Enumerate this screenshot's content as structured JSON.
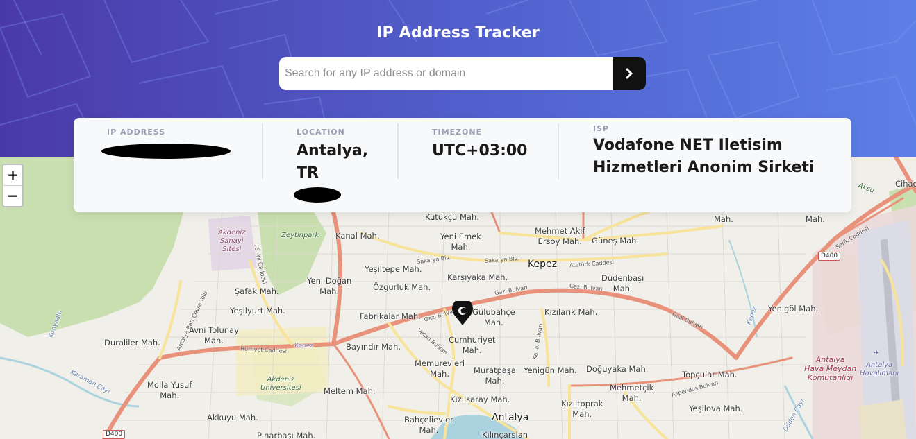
{
  "header": {
    "title": "IP Address Tracker",
    "search": {
      "placeholder": "Search for any IP address or domain",
      "value": "",
      "submit_icon": "chevron-right-icon"
    }
  },
  "info": {
    "ip_address": {
      "label": "IP ADDRESS",
      "value": ""
    },
    "location": {
      "label": "LOCATION",
      "value_line1": "Antalya,",
      "value_line2": "TR"
    },
    "timezone": {
      "label": "TIMEZONE",
      "value": "UTC+03:00"
    },
    "isp": {
      "label": "ISP",
      "value_line1": "Vodafone NET Iletisim",
      "value_line2": "Hizmetleri Anonim Sirketi"
    }
  },
  "map": {
    "zoom_in": "+",
    "zoom_out": "−",
    "marker_icon": "location-pin-icon",
    "labels": {
      "kutukcu": "Kütükçü Mah.",
      "kanal": "Kanal Mah.",
      "yeni_emek_1": "Yeni Emek",
      "yeni_emek_2": "Mah.",
      "mehmet_akif_1": "Mehmet Akif",
      "mehmet_akif_2": "Ersoy Mah.",
      "gunes": "Güneş Mah.",
      "kepez": "Kepez",
      "yesiltepe": "Yeşiltepe Mah.",
      "yeni_dogan_1": "Yeni Doğan",
      "yeni_dogan_2": "Mah.",
      "ozgurluk": "Özgürlük Mah.",
      "karsiyaka": "Karşıyaka Mah.",
      "dudenbasi_1": "Düdenbaşı",
      "dudenbasi_2": "Mah.",
      "safak": "Şafak Mah.",
      "yesilyurt": "Yeşilyurt Mah.",
      "fabrikalar": "Fabrikalar Mah.",
      "gulubahce_1": "Gülubahçe",
      "gulubahce_2": "Mah.",
      "kizilarik": "Kızılarık Mah.",
      "yenigol": "Yenigöl Mah.",
      "avni_1": "Avni Tolunay",
      "avni_2": "Mah.",
      "duraliler": "Duraliler Mah.",
      "bayindir": "Bayındır Mah.",
      "cumhuriyet_1": "Cumhuriyet",
      "cumhuriyet_2": "Mah.",
      "memurevleri_1": "Memurevleri",
      "memurevleri_2": "Mah.",
      "muratpasa_1": "Muratpaşa",
      "muratpasa_2": "Mah.",
      "yenigun": "Yenigün Mah.",
      "doguyaka": "Doğuyaka Mah.",
      "topcular": "Topçular Mah.",
      "molla_1": "Molla Yusuf",
      "molla_2": "Mah.",
      "meltem": "Meltem Mah.",
      "mehmetcik_1": "Mehmetçik",
      "mehmetcik_2": "Mah.",
      "kizilsaray": "Kızılsaray Mah.",
      "kiziltoprak_1": "Kızıltoprak",
      "kiziltoprak_2": "Mah.",
      "akkuyu": "Akkuyu Mah.",
      "bahcelievler_1": "Bahçelievler",
      "bahcelievler_2": "Mah.",
      "antalya": "Antalya",
      "yesilova": "Yeşilova Mah.",
      "pinarbasi": "Pınarbaşı Mah.",
      "kilincarslan": "Kılınçarslan",
      "mah_top_right_1": "Mah.",
      "mah_top_right_2": "Mah.",
      "cihad": "Cihad",
      "aksu": "Aksu",
      "zeytinpark": "Zeytinpark",
      "akdeniz_sanayi_1": "Akdeniz",
      "akdeniz_sanayi_2": "Sanayi",
      "akdeniz_sanayi_3": "Sitesi",
      "akdeniz_uni_1": "Akdeniz",
      "akdeniz_uni_2": "Üniversitesi",
      "hava_1": "Antalya",
      "hava_2": "Hava Meydan",
      "hava_3": "Komutanlığı",
      "havalimani_1": "Antalya",
      "havalimani_2": "Havalimanı",
      "kepez_small": "Kepez",
      "konyaalti": "Konyaaltı",
      "karaman_cayi": "Karaman Çayı",
      "duden_cayi": "Düden Çayı",
      "kepez_canal": "Kepez"
    },
    "roads": {
      "gazi_1": "Gazi Bulvarı",
      "gazi_2": "Gazi Bulvarı",
      "gazi_3": "Gazi Bulvarı",
      "gazi_4": "Gazi Bulvarı",
      "sakarya_1": "Sakarya Blv.",
      "sakarya_2": "Sakarya Blv.",
      "ataturk": "Atatürk Caddesi",
      "hurriyet": "Hürriyet Caddesi",
      "aspendos": "Aspendos Bulvarı",
      "serik": "Serik Caddesi",
      "yil75": "75. Yıl Caddesi",
      "vatan": "Vatan Bulvarı",
      "kabul": "Kanal Bulvarı",
      "antalya_bati": "Antalya Batı Çevre Yolu"
    },
    "shields": {
      "d400_right": "D400",
      "d400_left": "D400"
    }
  }
}
